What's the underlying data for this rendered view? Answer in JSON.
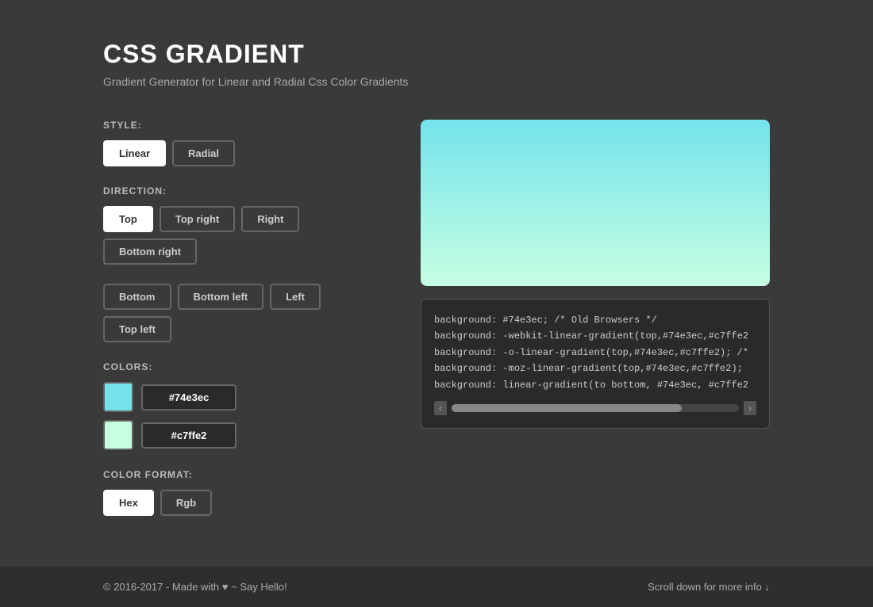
{
  "header": {
    "title": "CSS GRADIENT",
    "subtitle": "Gradient Generator for Linear and Radial Css Color Gradients"
  },
  "style_section": {
    "label": "STYLE:",
    "buttons": [
      {
        "id": "linear",
        "label": "Linear",
        "active": true
      },
      {
        "id": "radial",
        "label": "Radial",
        "active": false
      }
    ]
  },
  "direction_section": {
    "label": "DIRECTION:",
    "row1": [
      {
        "id": "top",
        "label": "Top",
        "active": true
      },
      {
        "id": "top-right",
        "label": "Top right",
        "active": false
      },
      {
        "id": "right",
        "label": "Right",
        "active": false
      },
      {
        "id": "bottom-right",
        "label": "Bottom right",
        "active": false
      }
    ],
    "row2": [
      {
        "id": "bottom",
        "label": "Bottom",
        "active": false
      },
      {
        "id": "bottom-left",
        "label": "Bottom left",
        "active": false
      },
      {
        "id": "left",
        "label": "Left",
        "active": false
      },
      {
        "id": "top-left",
        "label": "Top left",
        "active": false
      }
    ]
  },
  "colors_section": {
    "label": "COLORS:",
    "colors": [
      {
        "id": "color1",
        "swatch": "#74e3ec",
        "value": "#74e3ec"
      },
      {
        "id": "color2",
        "swatch": "#c7ffe2",
        "value": "#c7ffe2"
      }
    ]
  },
  "format_section": {
    "label": "COLOR FORMAT:",
    "buttons": [
      {
        "id": "hex",
        "label": "Hex",
        "active": true
      },
      {
        "id": "rgb",
        "label": "Rgb",
        "active": false
      }
    ]
  },
  "gradient": {
    "color1": "#74e3ec",
    "color2": "#c7ffe2",
    "direction": "to bottom"
  },
  "code": {
    "lines": [
      "background: #74e3ec; /* Old Browsers */",
      "background: -webkit-linear-gradient(top,#74e3ec,#c7ffe2",
      "background: -o-linear-gradient(top,#74e3ec,#c7ffe2); /*",
      "background: -moz-linear-gradient(top,#74e3ec,#c7ffe2);",
      "background: linear-gradient(to bottom, #74e3ec, #c7ffe2"
    ]
  },
  "footer": {
    "left": "© 2016-2017 - Made with ♥ ~",
    "link_label": "Say Hello!",
    "right": "Scroll down for more info ↓"
  }
}
